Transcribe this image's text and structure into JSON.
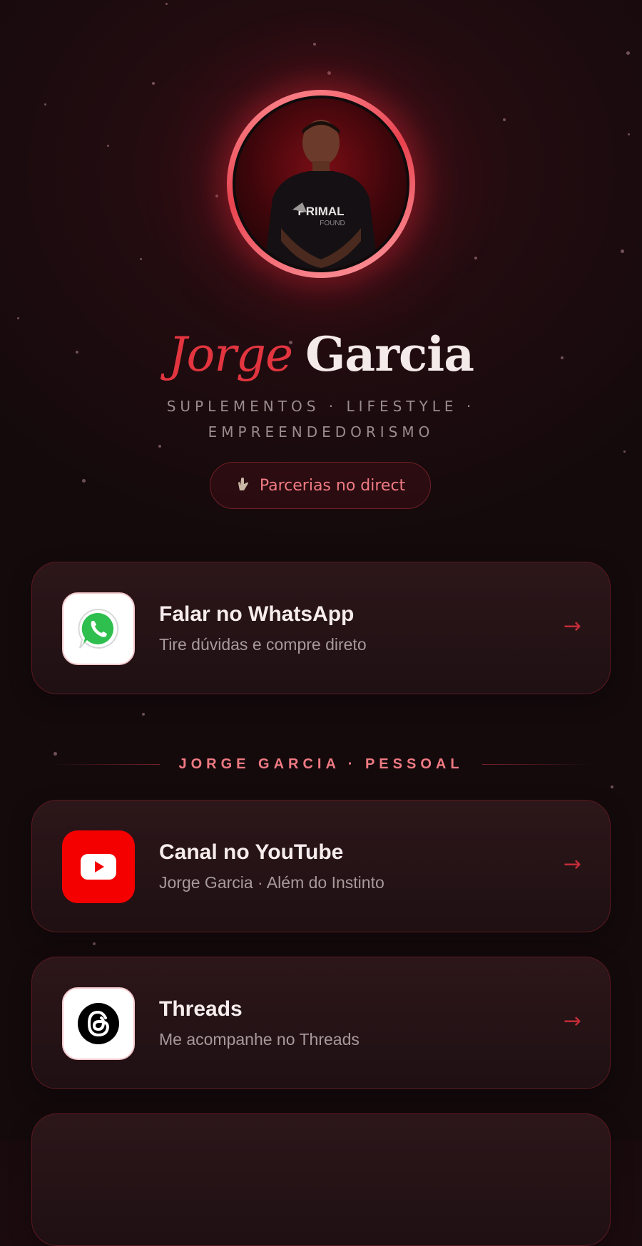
{
  "profile": {
    "first_name": "Jorge",
    "last_name": "Garcia",
    "tagline": "SUPLEMENTOS · LIFESTYLE · EMPREENDEDORISMO",
    "shirt_text": "PRIMAL",
    "shirt_subtext": "FOUND"
  },
  "pill": {
    "label": "Parcerias no direct",
    "icon": "hand-icon"
  },
  "links": [
    {
      "title": "Falar no WhatsApp",
      "subtitle": "Tire dúvidas e compre direto",
      "icon": "whatsapp-icon"
    },
    {
      "title": "Canal no YouTube",
      "subtitle": "Jorge Garcia · Além do Instinto",
      "icon": "youtube-icon"
    },
    {
      "title": "Threads",
      "subtitle": "Me acompanhe no Threads",
      "icon": "threads-icon"
    }
  ],
  "section": {
    "label": "JORGE GARCIA · PESSOAL"
  },
  "arrow_glyph": "→",
  "colors": {
    "accent": "#e2353f",
    "background": "#140a0c",
    "card_border": "#5a1920"
  }
}
